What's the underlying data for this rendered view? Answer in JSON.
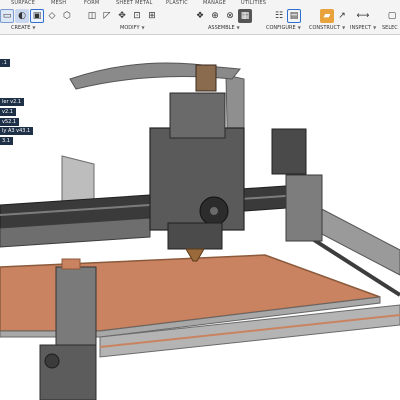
{
  "toolbar": {
    "tabs": [
      {
        "label": "SURFACE"
      },
      {
        "label": "MESH"
      },
      {
        "label": "FORM"
      },
      {
        "label": "SHEET METAL"
      },
      {
        "label": "PLASTIC"
      },
      {
        "label": "MANAGE"
      },
      {
        "label": "UTILITIES"
      }
    ],
    "groups": {
      "create": "CREATE",
      "modify": "MODIFY",
      "assemble": "ASSEMBLE",
      "configure": "CONFIGURE",
      "construct": "CONSTRUCT",
      "inspect": "INSPECT",
      "select": "SELEC"
    }
  },
  "browser": {
    "items": [
      {
        "label": ".1"
      },
      {
        "label": "ler v2.1"
      },
      {
        "label": "v2.1"
      },
      {
        "label": "v52.1"
      },
      {
        "label": "ly A3 v43.1"
      },
      {
        "label": "3.1"
      }
    ]
  },
  "colors": {
    "accent_blue": "#2f6fd0",
    "toolbar_bg": "#f4f4f4",
    "browser_bg": "#1f3147",
    "bed_copper": "#c98360",
    "frame_gray": "#9c9c9c"
  }
}
